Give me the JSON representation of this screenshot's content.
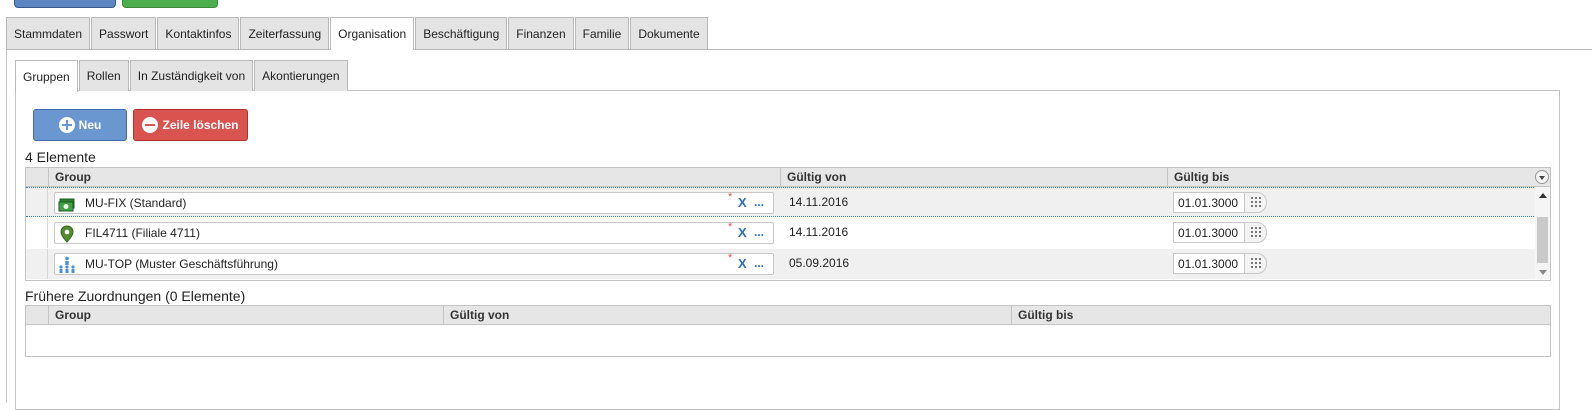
{
  "main_tabs": [
    {
      "label": "Stammdaten"
    },
    {
      "label": "Passwort"
    },
    {
      "label": "Kontaktinfos"
    },
    {
      "label": "Zeiterfassung"
    },
    {
      "label": "Organisation",
      "active": true
    },
    {
      "label": "Beschäftigung"
    },
    {
      "label": "Finanzen"
    },
    {
      "label": "Familie"
    },
    {
      "label": "Dokumente"
    }
  ],
  "sub_tabs": [
    {
      "label": "Gruppen",
      "active": true
    },
    {
      "label": "Rollen"
    },
    {
      "label": "In Zuständigkeit von"
    },
    {
      "label": "Akontierungen"
    }
  ],
  "toolbar": {
    "new_label": "Neu",
    "delete_label": "Zeile löschen"
  },
  "current": {
    "title": "4 Elemente",
    "columns": {
      "group": "Group",
      "valid_from": "Gültig von",
      "valid_to": "Gültig bis"
    },
    "rows": [
      {
        "group": "MU-FIX (Standard)",
        "icon": "money-icon",
        "valid_from": "14.11.2016",
        "valid_to": "01.01.3000"
      },
      {
        "group": "FIL4711 (Filiale 4711)",
        "icon": "location-pin-icon",
        "valid_from": "14.11.2016",
        "valid_to": "01.01.3000"
      },
      {
        "group": "MU-TOP (Muster Geschäftsführung)",
        "icon": "org-chart-icon",
        "valid_from": "05.09.2016",
        "valid_to": "01.01.3000"
      }
    ],
    "required_mark": "*",
    "clear_label": "X",
    "more_label": "..."
  },
  "previous": {
    "title": "Frühere Zuordnungen (0 Elemente)",
    "columns": {
      "group": "Group",
      "valid_from": "Gültig von",
      "valid_to": "Gültig bis"
    }
  },
  "colors": {
    "primary_button": "#6a97d0",
    "danger_button": "#d9534f",
    "link_blue": "#2c6fc0"
  }
}
